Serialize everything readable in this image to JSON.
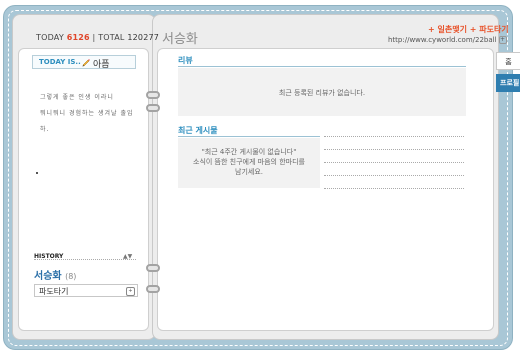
{
  "header": {
    "today_label": "TODAY",
    "today_count": "6126",
    "divider": "|",
    "total_label": "TOTAL",
    "total_count": "120277",
    "minihompy_title": "서승화",
    "link_friend": "+ 일촌맺기",
    "link_visit": "+ 파도타기",
    "url": "http://www.cyworld.com/22ball",
    "url_plus": "+"
  },
  "left": {
    "today_is_label": "TODAY IS..",
    "mood": "아픔",
    "intro_lines": [
      "그렇게 좋은 인생 이라니",
      "뭐니뭐니 경험하는 생겨날 출입하."
    ],
    "history_label": "HISTORY",
    "history_arrows": "▲▼",
    "owner_name": "서승화",
    "owner_count": "(8)",
    "select_value": "파도타기",
    "select_btn": "+"
  },
  "right": {
    "review_title": "리뷰",
    "review_empty": "최근 등록된 리뷰가 없습니다.",
    "posts_title": "최근 게시물",
    "posts_empty_line1": "\"최근 4주간 게시물이 없습니다\"",
    "posts_empty_line2": "소식이 뜸한 친구에게 마음의 한마디를",
    "posts_empty_line3": "남기세요."
  },
  "tabs": {
    "home": "홈",
    "profile": "프로필"
  },
  "colors": {
    "frame": "#a9c7d6",
    "accent_blue": "#2e8fbf",
    "accent_orange": "#e8542c",
    "tab_active": "#2f7eb0"
  }
}
